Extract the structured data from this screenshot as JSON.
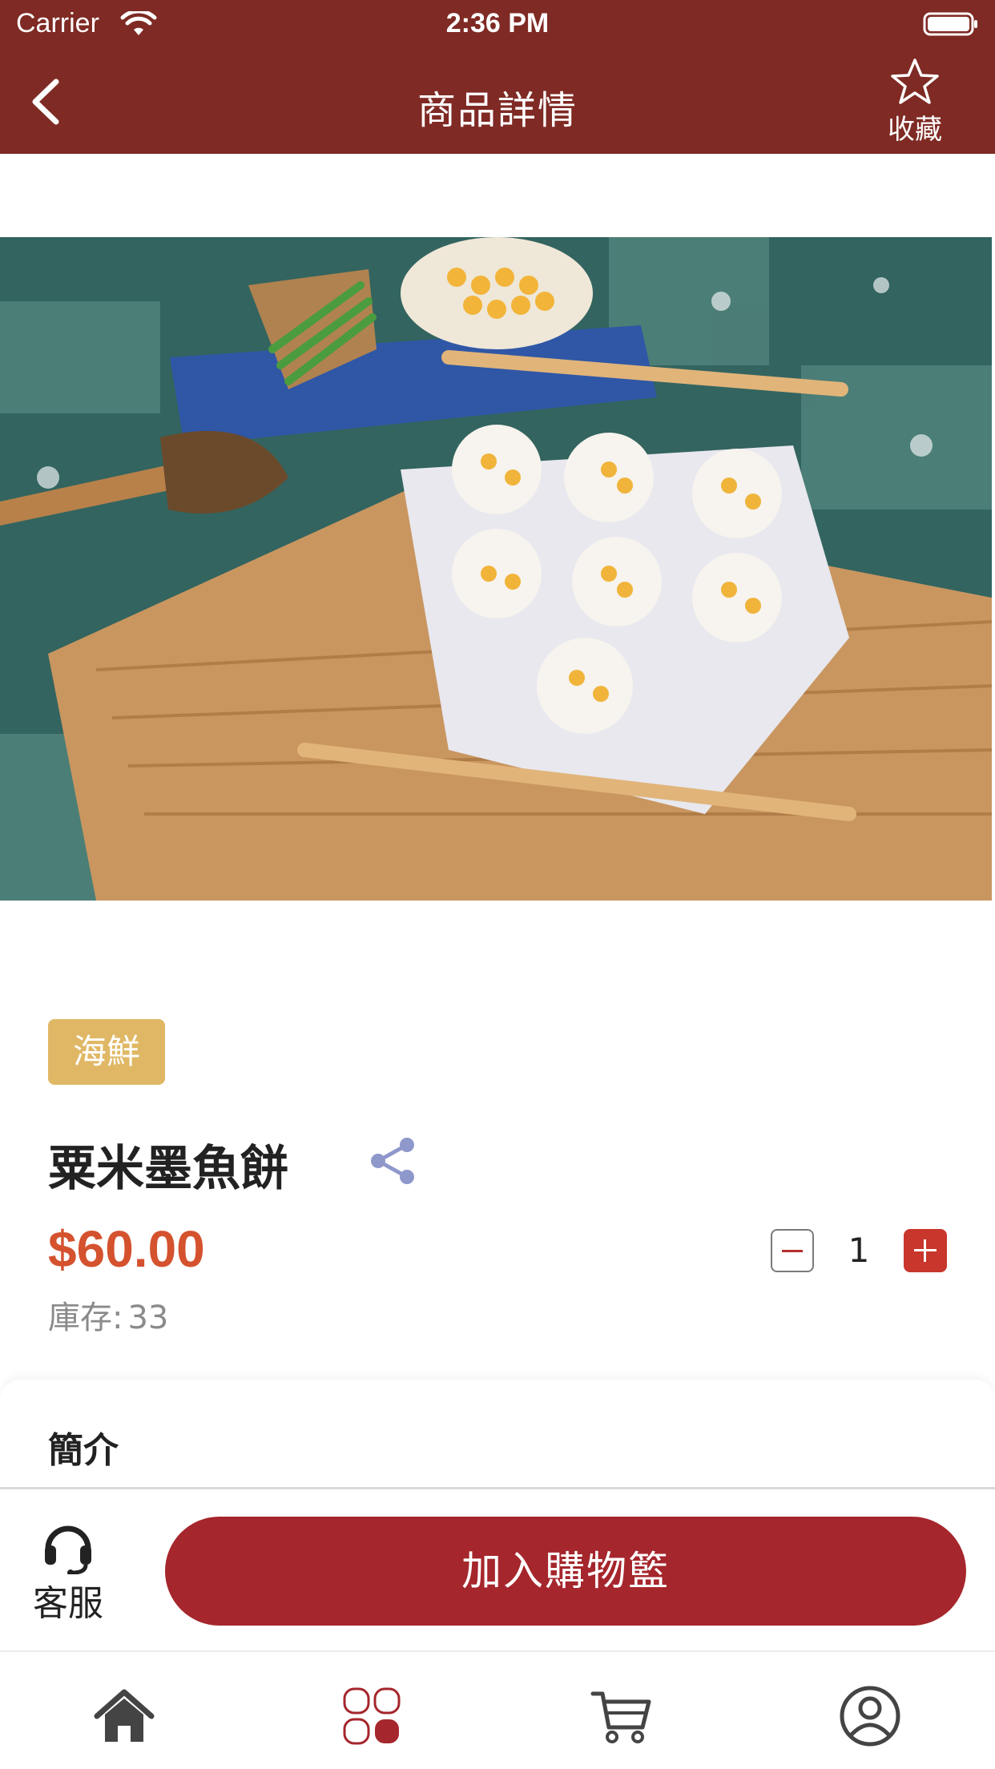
{
  "status_bar": {
    "carrier": "Carrier",
    "time": "2:36 PM"
  },
  "nav": {
    "title": "商品詳情",
    "favorite_label": "收藏"
  },
  "product": {
    "category_tag": "海鮮",
    "name": "粟米墨魚餅",
    "price": "$60.00",
    "stock_label": "庫存:",
    "stock_value": "33",
    "quantity": "1"
  },
  "intro": {
    "title": "簡介"
  },
  "action_bar": {
    "customer_service_label": "客服",
    "add_to_cart_label": "加入購物籃"
  },
  "tab_bar": {
    "items": [
      {
        "icon": "home-icon"
      },
      {
        "icon": "category-icon"
      },
      {
        "icon": "cart-icon"
      },
      {
        "icon": "profile-icon"
      }
    ]
  },
  "colors": {
    "primary": "#7f2a24",
    "button": "#a5262c",
    "price": "#d4522e",
    "tag": "#e0b865",
    "plus_button": "#c8362c"
  }
}
